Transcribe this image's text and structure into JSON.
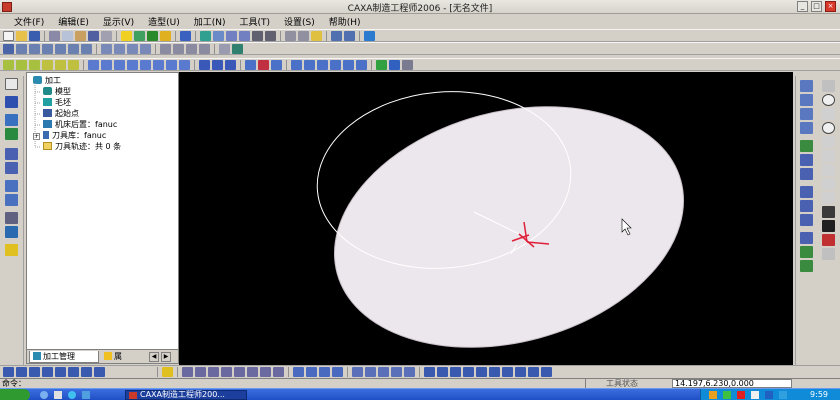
{
  "window": {
    "title": "CAXA制造工程师2006 - [无名文件]",
    "controls": {
      "min": "_",
      "max": "□",
      "close": "×"
    }
  },
  "menu": [
    "文件(F)",
    "编辑(E)",
    "显示(V)",
    "造型(U)",
    "加工(N)",
    "工具(T)",
    "设置(S)",
    "帮助(H)"
  ],
  "tree": {
    "root": "加工",
    "items": [
      "模型",
      "毛坯",
      "起始点",
      "机床后置：fanuc",
      "刀具库：fanuc",
      "刀具轨迹：共 0 条"
    ]
  },
  "panel_tabs": {
    "tab1": "加工管理",
    "tab2": "属"
  },
  "status": {
    "command_label": "命令：",
    "tool_state": "工具状态",
    "coords": "14.197,6.230,0.000"
  },
  "taskbar": {
    "task_label": "CAXA制造工程师200...",
    "clock": "9:59"
  },
  "colors": {
    "canvas_bg": "#000000",
    "solid_fill": "#ece7ec",
    "wire": "#ffffff",
    "axis": "#e0203a"
  }
}
